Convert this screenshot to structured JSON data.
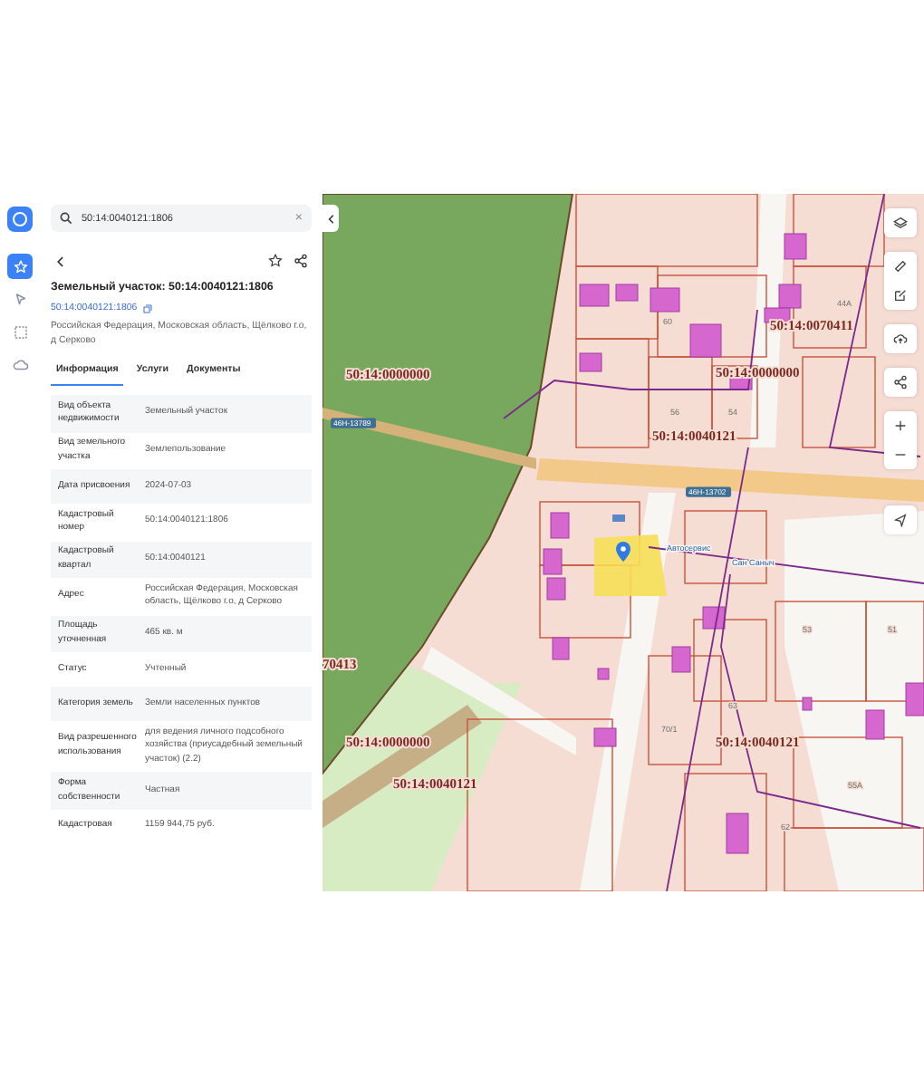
{
  "rail": [
    {
      "selected": true
    },
    {
      "selected": false
    },
    {
      "selected": false
    },
    {
      "selected": false
    }
  ],
  "search": {
    "value": "50:14:0040121:1806",
    "clear": "×"
  },
  "card": {
    "title": "Земельный участок: 50:14:0040121:1806",
    "number": "50:14:0040121:1806",
    "address": "Российская Федерация, Московская область, Щёлково г.о, д Серково"
  },
  "tabs": [
    {
      "label": "Информация",
      "selected": true
    },
    {
      "label": "Услуги",
      "selected": false
    },
    {
      "label": "Документы",
      "selected": false
    }
  ],
  "rows": [
    {
      "label": "Вид объекта недвижимости",
      "value": "Земельный участок"
    },
    {
      "label": "Вид земельного участка",
      "value": "Землепользование"
    },
    {
      "label": "Дата присвоения",
      "value": "2024-07-03"
    },
    {
      "label": "Кадастровый номер",
      "value": "50:14:0040121:1806"
    },
    {
      "label": "Кадастровый квартал",
      "value": "50:14:0040121"
    },
    {
      "label": "Адрес",
      "value": "Российская Федерация, Московская область, Щёлково г.о, д Серково"
    },
    {
      "label": "Площадь уточненная",
      "value": "465 кв. м"
    },
    {
      "label": "Статус",
      "value": "Учтенный"
    },
    {
      "label": "Категория земель",
      "value": "Земли населенных пунктов"
    },
    {
      "label": "Вид разрешенного использования",
      "value": "для ведения личного подсобного хозяйства (приусадебный земельный участок) (2.2)"
    },
    {
      "label": "Форма собственности",
      "value": "Частная"
    },
    {
      "label": "Кадастровая",
      "value": "1159 944,75 руб."
    }
  ],
  "map": {
    "labels": [
      {
        "text": "50:14:0000000",
        "kind": "cadastral"
      },
      {
        "text": "50:14:0070411",
        "kind": "cadastral"
      },
      {
        "text": "50:14:0000000",
        "kind": "cadastral"
      },
      {
        "text": "50:14:0040121",
        "kind": "cadastral"
      },
      {
        "text": "70413",
        "kind": "cadastral"
      },
      {
        "text": "50:14:0000000",
        "kind": "cadastral"
      },
      {
        "text": "50:14:0040121",
        "kind": "cadastral"
      },
      {
        "text": "50:14:0040121",
        "kind": "cadastral"
      },
      {
        "text": "46Н-13789",
        "kind": "road"
      },
      {
        "text": "46Н-13702",
        "kind": "road"
      },
      {
        "text": "Автосервис",
        "kind": "poi"
      },
      {
        "text": "Сан Саныч",
        "kind": "poi"
      },
      {
        "text": "44А",
        "kind": "house"
      },
      {
        "text": "56",
        "kind": "house"
      },
      {
        "text": "54",
        "kind": "house"
      },
      {
        "text": "60",
        "kind": "house"
      },
      {
        "text": "63",
        "kind": "house"
      },
      {
        "text": "70/1",
        "kind": "house"
      },
      {
        "text": "53",
        "kind": "house"
      },
      {
        "text": "51",
        "kind": "house"
      },
      {
        "text": "55А",
        "kind": "house"
      },
      {
        "text": "62",
        "kind": "house"
      }
    ]
  }
}
